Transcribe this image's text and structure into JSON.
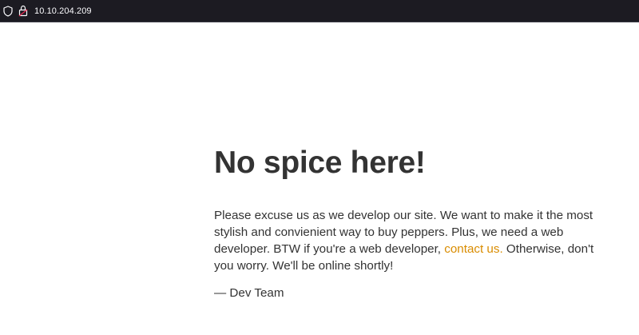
{
  "browser": {
    "url": "10.10.204.209",
    "icons": [
      "shield-icon",
      "lock-icon"
    ]
  },
  "page": {
    "title": "No spice here!",
    "paragraph_before_link": "Please excuse us as we develop our site. We want to make it the most stylish and convienient way to buy peppers. Plus, we need a web developer. BTW if you're a web developer, ",
    "link_text": "contact us.",
    "paragraph_after_link": " Otherwise, don't you worry. We'll be online shortly!",
    "signature": "— Dev Team"
  },
  "colors": {
    "browser_bar": "#1c1b22",
    "text": "#333333",
    "link": "#d98c00",
    "background": "#ffffff"
  }
}
